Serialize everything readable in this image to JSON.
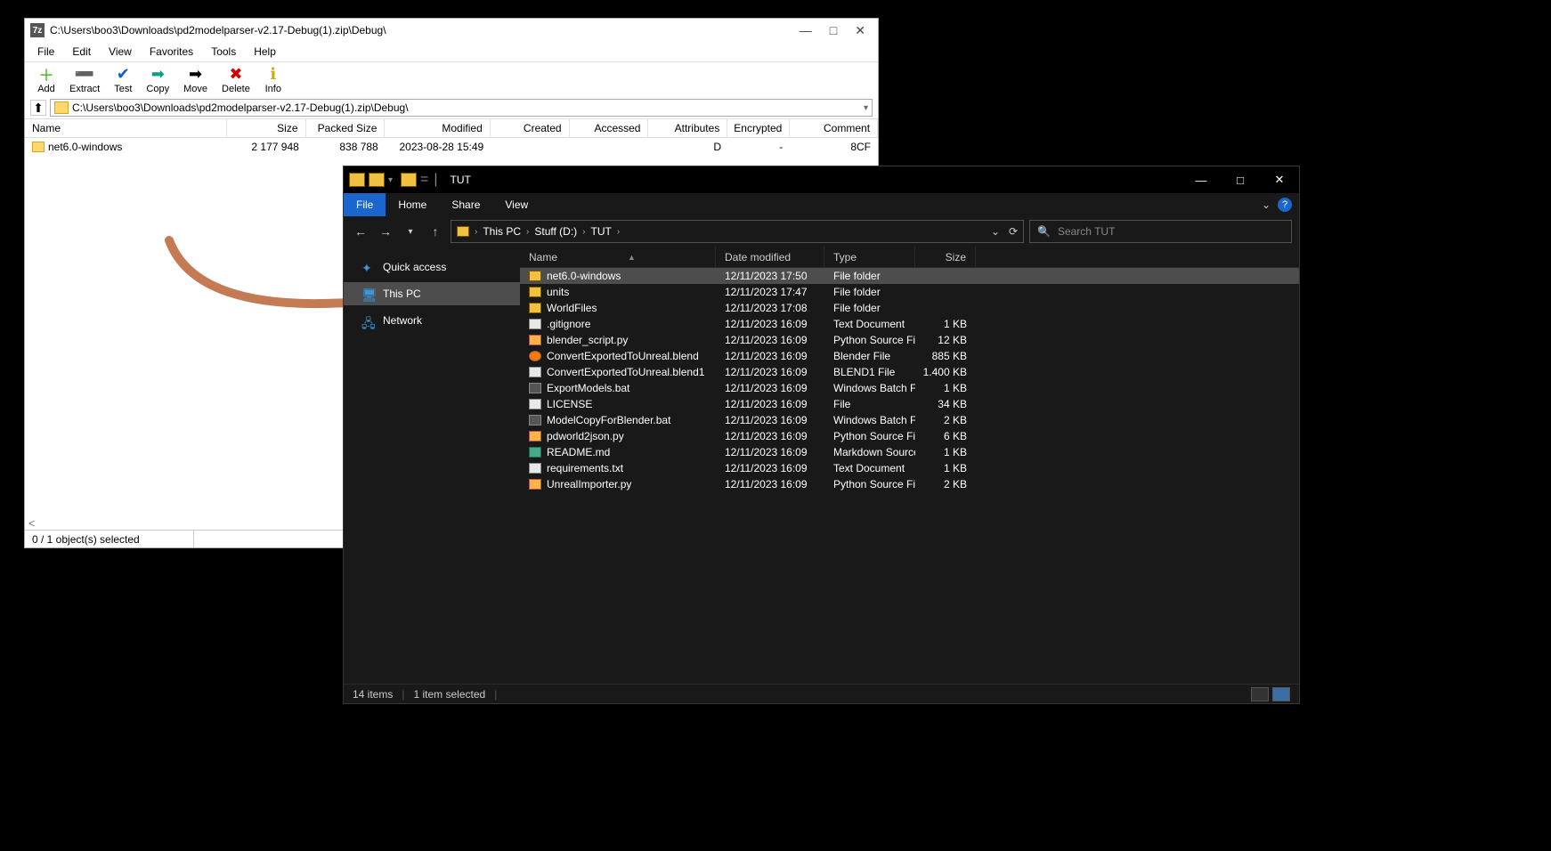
{
  "zip": {
    "title": "C:\\Users\\boo3\\Downloads\\pd2modelparser-v2.17-Debug(1).zip\\Debug\\",
    "menu": [
      "File",
      "Edit",
      "View",
      "Favorites",
      "Tools",
      "Help"
    ],
    "toolbar": [
      {
        "icon": "＋",
        "color": "#2ab000",
        "label": "Add"
      },
      {
        "icon": "➖",
        "color": "#1060c0",
        "label": "Extract"
      },
      {
        "icon": "✔",
        "color": "#1060c0",
        "label": "Test"
      },
      {
        "icon": "➡",
        "color": "#00a080",
        "label": "Copy"
      },
      {
        "icon": "➡",
        "color": "#000",
        "label": "Move"
      },
      {
        "icon": "✖",
        "color": "#d00000",
        "label": "Delete"
      },
      {
        "icon": "ℹ",
        "color": "#d9a400",
        "label": "Info"
      }
    ],
    "path": "C:\\Users\\boo3\\Downloads\\pd2modelparser-v2.17-Debug(1).zip\\Debug\\",
    "columns": [
      "Name",
      "Size",
      "Packed Size",
      "Modified",
      "Created",
      "Accessed",
      "Attributes",
      "Encrypted",
      "Comment"
    ],
    "row": {
      "name": "net6.0-windows",
      "size": "2 177 948",
      "packed": "838 788",
      "modified": "2023-08-28 15:49",
      "created": "",
      "accessed": "",
      "attributes": "D",
      "encrypted": "-",
      "comment": "8CF"
    },
    "status": "0 / 1 object(s) selected"
  },
  "explorer": {
    "title": "TUT",
    "ribbon": {
      "file": "File",
      "tabs": [
        "Home",
        "Share",
        "View"
      ]
    },
    "breadcrumb": [
      "This PC",
      "Stuff (D:)",
      "TUT"
    ],
    "search_placeholder": "Search TUT",
    "sidebar": [
      {
        "icon": "star",
        "label": "Quick access"
      },
      {
        "icon": "pc",
        "label": "This PC",
        "selected": true
      },
      {
        "icon": "net",
        "label": "Network"
      }
    ],
    "list_columns": [
      "Name",
      "Date modified",
      "Type",
      "Size"
    ],
    "files": [
      {
        "icon": "folder",
        "name": "net6.0-windows",
        "date": "12/11/2023 17:50",
        "type": "File folder",
        "size": "",
        "selected": true
      },
      {
        "icon": "folder",
        "name": "units",
        "date": "12/11/2023 17:47",
        "type": "File folder",
        "size": ""
      },
      {
        "icon": "folder",
        "name": "WorldFiles",
        "date": "12/11/2023 17:08",
        "type": "File folder",
        "size": ""
      },
      {
        "icon": "doc",
        "name": ".gitignore",
        "date": "12/11/2023 16:09",
        "type": "Text Document",
        "size": "1 KB"
      },
      {
        "icon": "py",
        "name": "blender_script.py",
        "date": "12/11/2023 16:09",
        "type": "Python Source File",
        "size": "12 KB"
      },
      {
        "icon": "blend",
        "name": "ConvertExportedToUnreal.blend",
        "date": "12/11/2023 16:09",
        "type": "Blender File",
        "size": "885 KB"
      },
      {
        "icon": "doc",
        "name": "ConvertExportedToUnreal.blend1",
        "date": "12/11/2023 16:09",
        "type": "BLEND1 File",
        "size": "1.400 KB"
      },
      {
        "icon": "bat",
        "name": "ExportModels.bat",
        "date": "12/11/2023 16:09",
        "type": "Windows Batch File",
        "size": "1 KB"
      },
      {
        "icon": "doc",
        "name": "LICENSE",
        "date": "12/11/2023 16:09",
        "type": "File",
        "size": "34 KB"
      },
      {
        "icon": "bat",
        "name": "ModelCopyForBlender.bat",
        "date": "12/11/2023 16:09",
        "type": "Windows Batch File",
        "size": "2 KB"
      },
      {
        "icon": "py",
        "name": "pdworld2json.py",
        "date": "12/11/2023 16:09",
        "type": "Python Source File",
        "size": "6 KB"
      },
      {
        "icon": "md",
        "name": "README.md",
        "date": "12/11/2023 16:09",
        "type": "Markdown Source...",
        "size": "1 KB"
      },
      {
        "icon": "doc",
        "name": "requirements.txt",
        "date": "12/11/2023 16:09",
        "type": "Text Document",
        "size": "1 KB"
      },
      {
        "icon": "py",
        "name": "UnrealImporter.py",
        "date": "12/11/2023 16:09",
        "type": "Python Source File",
        "size": "2 KB"
      }
    ],
    "status_items": "14 items",
    "status_sel": "1 item selected"
  }
}
